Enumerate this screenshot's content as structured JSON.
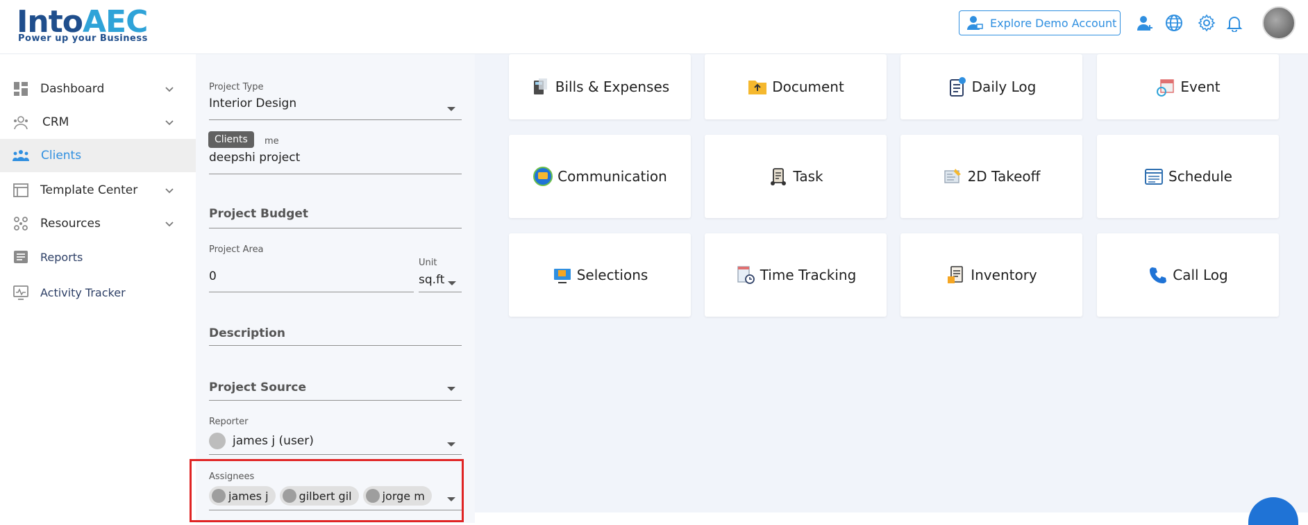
{
  "header": {
    "logo_text": "IntoAEC",
    "logo_main": "Into",
    "logo_accent": "AEC",
    "logo_tagline": "Power up your Business",
    "demo_button": "Explore Demo Account",
    "icons": [
      "add-user-icon",
      "globe-icon",
      "gear-icon",
      "bell-icon"
    ]
  },
  "sidebar": {
    "items": [
      {
        "label": "Dashboard",
        "icon": "dashboard-icon",
        "has_chevron": true
      },
      {
        "label": "CRM",
        "icon": "crm-icon",
        "has_chevron": true
      },
      {
        "label": "Clients",
        "icon": "clients-icon",
        "has_chevron": false,
        "active": true
      },
      {
        "label": "Template Center",
        "icon": "template-icon",
        "has_chevron": true
      },
      {
        "label": "Resources",
        "icon": "resources-icon",
        "has_chevron": true
      },
      {
        "label": "Reports",
        "icon": "reports-icon",
        "has_chevron": false
      },
      {
        "label": "Activity Tracker",
        "icon": "activity-icon",
        "has_chevron": false
      }
    ],
    "tooltip": "Clients"
  },
  "form": {
    "project_type": {
      "label": "Project Type",
      "value": "Interior Design"
    },
    "project_name": {
      "label_visible": "me",
      "value": "deepshi project"
    },
    "project_budget": {
      "placeholder": "Project Budget"
    },
    "project_area": {
      "label": "Project Area",
      "value": "0"
    },
    "unit": {
      "label": "Unit",
      "value": "sq.ft"
    },
    "description": {
      "placeholder": "Description"
    },
    "project_source": {
      "placeholder": "Project Source"
    },
    "reporter": {
      "label": "Reporter",
      "value": "james j (user)"
    },
    "assignees": {
      "label": "Assignees",
      "chips": [
        "james j",
        "gilbert gil",
        "jorge m"
      ]
    }
  },
  "modules": [
    {
      "label": "Bills & Expenses",
      "icon": "bills-icon"
    },
    {
      "label": "Document",
      "icon": "document-icon"
    },
    {
      "label": "Daily Log",
      "icon": "daily-log-icon"
    },
    {
      "label": "Event",
      "icon": "event-icon"
    },
    {
      "label": "Communication",
      "icon": "communication-icon"
    },
    {
      "label": "Task",
      "icon": "task-icon"
    },
    {
      "label": "2D Takeoff",
      "icon": "takeoff-icon"
    },
    {
      "label": "Schedule",
      "icon": "schedule-icon"
    },
    {
      "label": "Selections",
      "icon": "selections-icon"
    },
    {
      "label": "Time Tracking",
      "icon": "time-tracking-icon"
    },
    {
      "label": "Inventory",
      "icon": "inventory-icon"
    },
    {
      "label": "Call Log",
      "icon": "phone-icon"
    }
  ],
  "colors": {
    "accent": "#2f8fe0",
    "highlight": "#e02424",
    "main_bg": "#f1f4fa"
  }
}
